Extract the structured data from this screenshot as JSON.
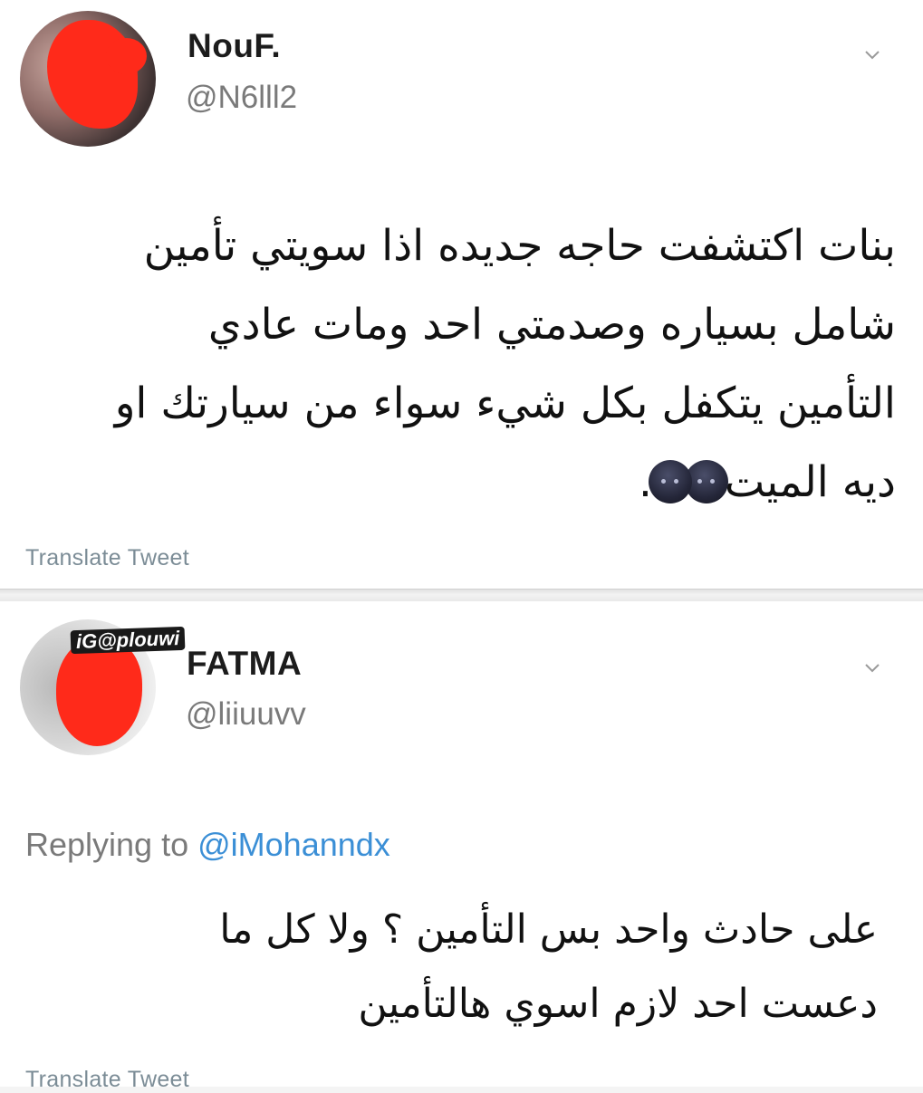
{
  "tweets": [
    {
      "name": "NouF.",
      "handle": "@N6lll2",
      "body_lines": [
        "بنات اكتشفت حاجه جديده اذا سويتي تأمين",
        "شامل بسياره وصدمتي احد ومات عادي",
        "التأمين يتكفل بكل شيء سواء من سيارتك او",
        "ديه الميت"
      ],
      "emoji_trailer": ".",
      "emoji_icon": "sweat-smile-dark-icon",
      "translate_label": "Translate Tweet"
    },
    {
      "name": "FATMA",
      "handle": "@liiuuvv",
      "watermark": "iG@plouwi",
      "replying_prefix": "Replying to",
      "replying_to": "@iMohanndx",
      "body_lines": [
        "على حادث واحد بس التأمين ؟ ولا كل ما",
        "دعست احد لازم اسوي هالتأمين"
      ],
      "translate_label": "Translate Tweet"
    }
  ],
  "colors": {
    "redaction": "#ff2a1a",
    "link": "#3b8fd6",
    "muted": "#7a7a7a",
    "translate": "#7b8c96"
  }
}
